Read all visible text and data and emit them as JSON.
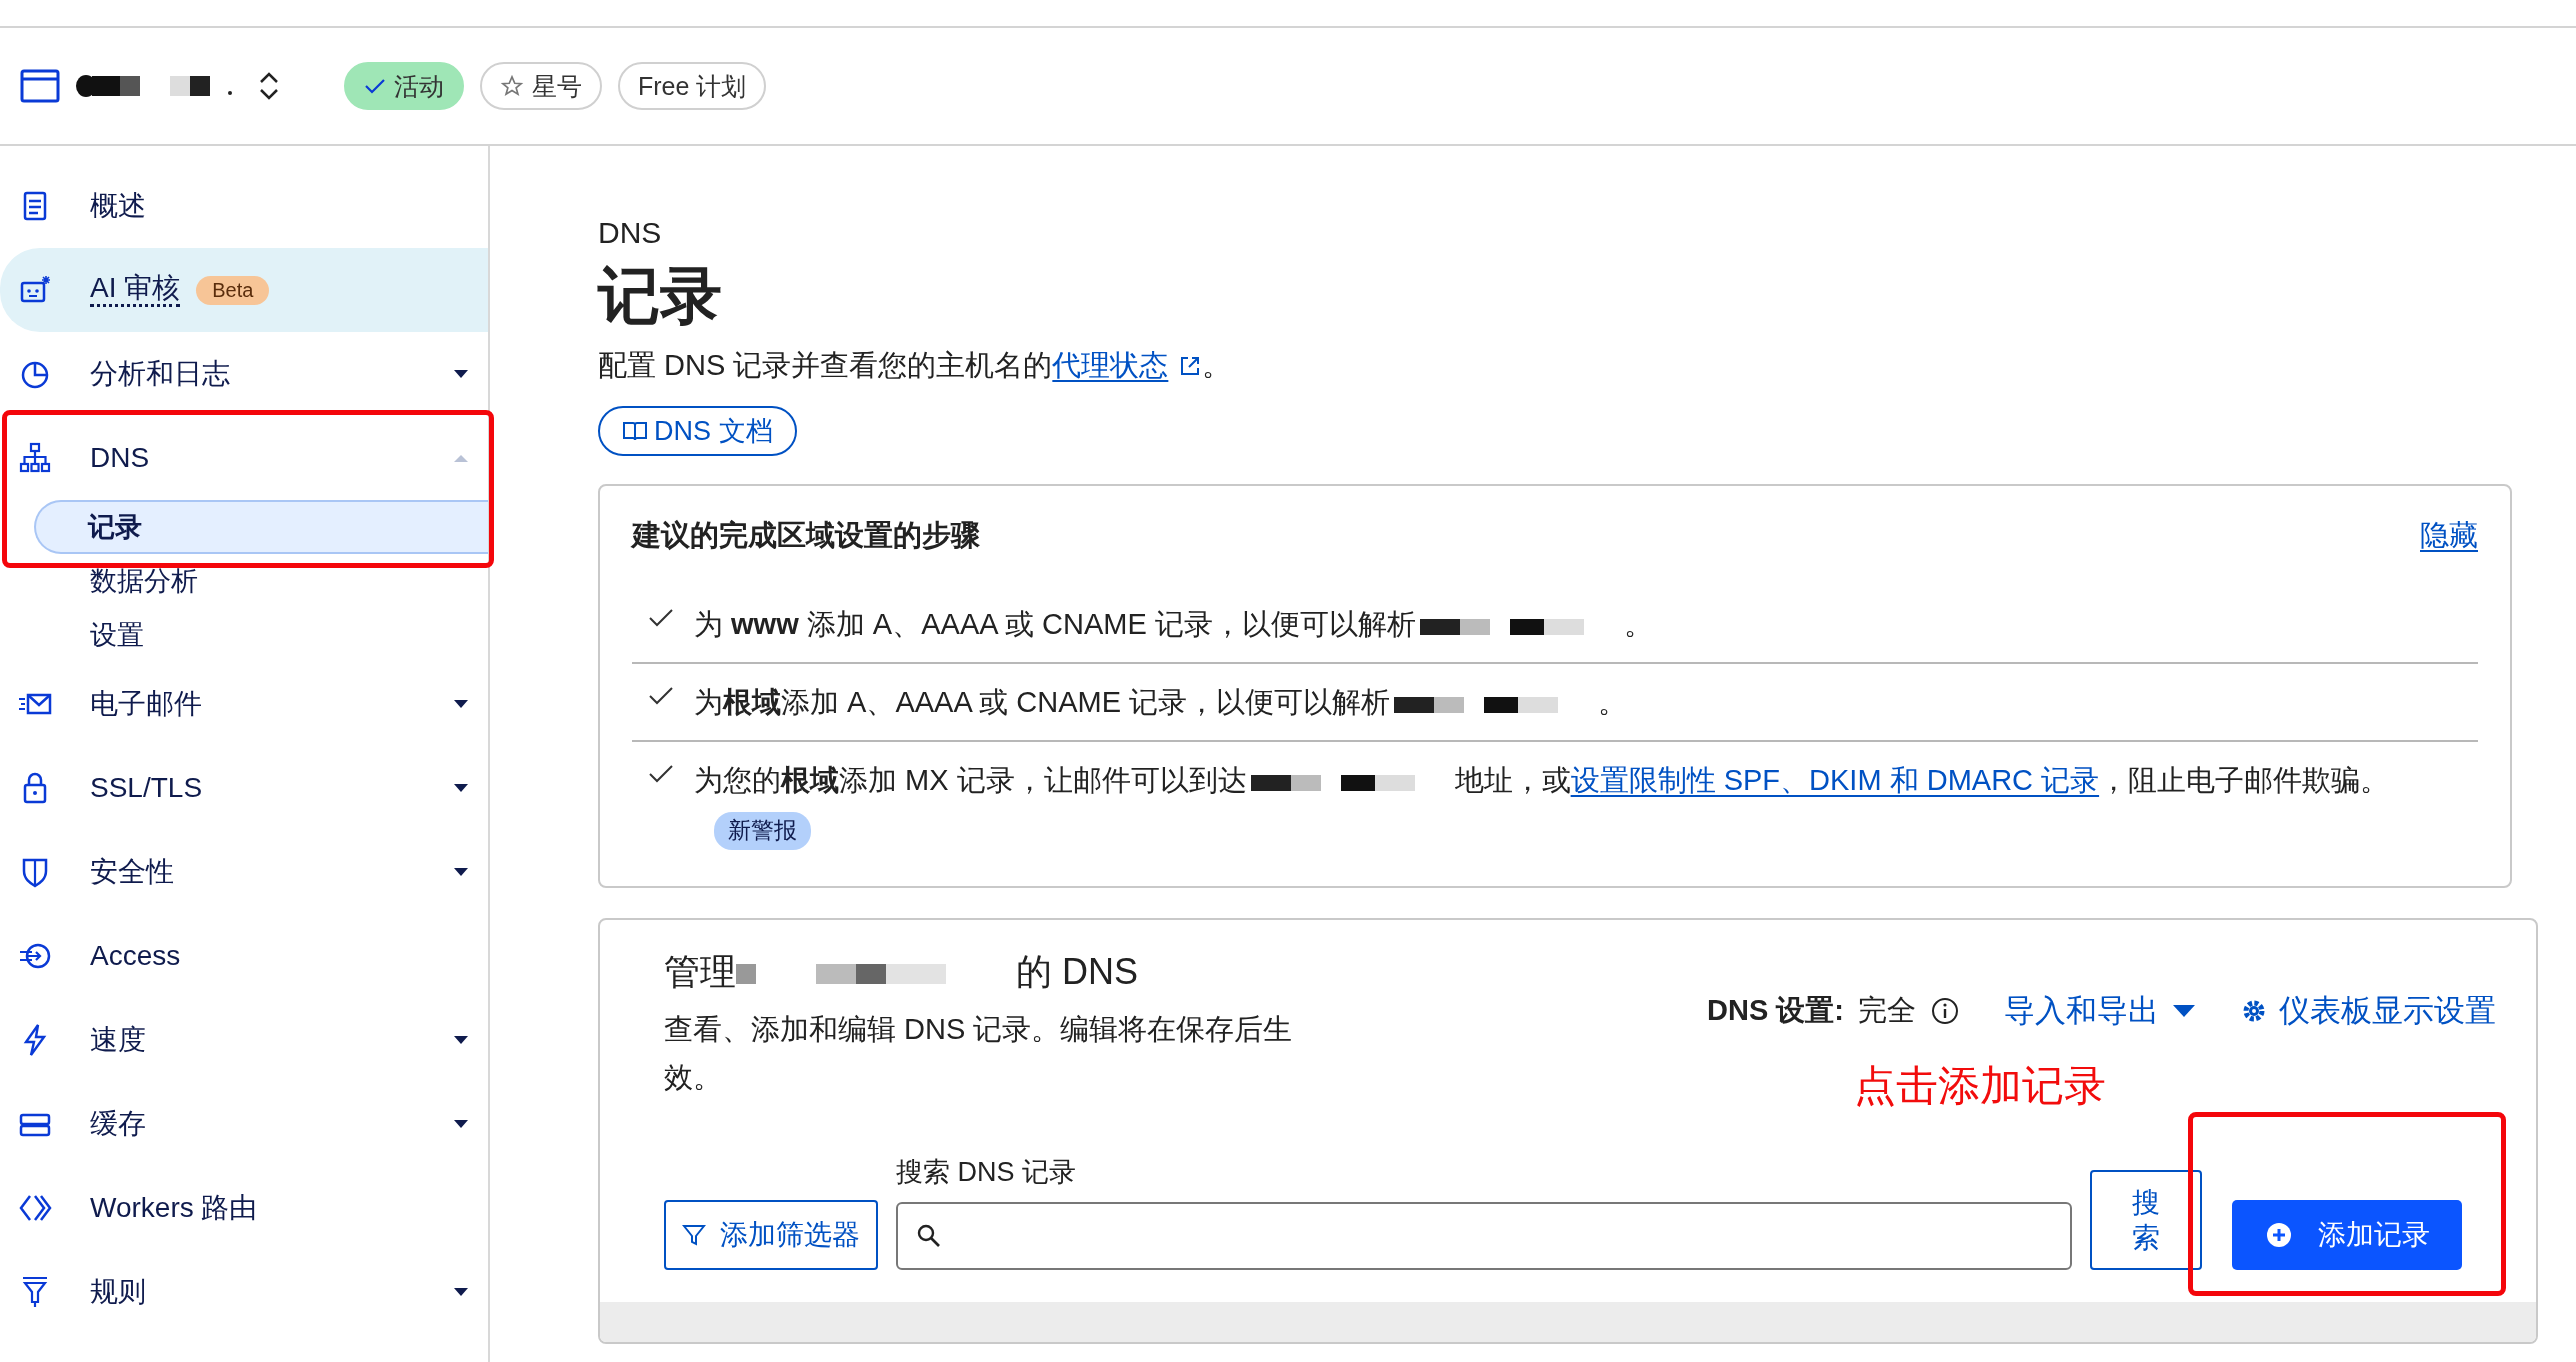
{
  "header": {
    "badges": [
      {
        "kind": "status",
        "label": "活动"
      },
      {
        "kind": "star",
        "label": "星号"
      },
      {
        "kind": "plan",
        "label": "Free 计划"
      }
    ]
  },
  "sidebar": {
    "items": [
      {
        "label": "概述",
        "highlighted": false
      },
      {
        "label": "AI 审核",
        "badge": "Beta",
        "highlighted": true
      },
      {
        "label": "分析和日志",
        "expanded": false,
        "highlighted": false
      },
      {
        "label": "DNS",
        "expanded": true,
        "highlighted": false,
        "children": [
          {
            "label": "记录",
            "selected": true
          },
          {
            "label": "数据分析",
            "selected": false
          },
          {
            "label": "设置",
            "selected": false
          }
        ]
      },
      {
        "label": "电子邮件",
        "expanded": false,
        "highlighted": false
      },
      {
        "label": "SSL/TLS",
        "expanded": false,
        "highlighted": false
      },
      {
        "label": "安全性",
        "expanded": false,
        "highlighted": false
      },
      {
        "label": "Access",
        "highlighted": false
      },
      {
        "label": "速度",
        "expanded": false,
        "highlighted": false
      },
      {
        "label": "缓存",
        "expanded": false,
        "highlighted": false
      },
      {
        "label": "Workers 路由",
        "highlighted": false
      },
      {
        "label": "规则",
        "expanded": false,
        "highlighted": false
      }
    ]
  },
  "page": {
    "section": "DNS",
    "title": "记录",
    "description": "配置 DNS 记录并查看您的主机名的",
    "description_link": "代理状态",
    "description_end": "。",
    "docs_button": "DNS 文档"
  },
  "setup_card": {
    "title": "建议的完成区域设置的步骤",
    "hide_link": "隐藏",
    "steps": [
      {
        "text": "为 **www** 添加 A、AAAA 或 CNAME 记录，以便可以解析",
        "after": "。"
      },
      {
        "text": "为**根域**添加 A、AAAA 或 CNAME 记录，以便可以解析",
        "after": "。"
      },
      {
        "text": "为您的**根域**添加 MX 记录，让邮件可以到达",
        "after": "地址，或",
        "link": "设置限制性 SPF、DKIM 和 DMARC 记录",
        "tail": "，阻止电子邮件欺骗。",
        "badge": "新警报"
      }
    ]
  },
  "manage_card": {
    "title_start": "管理",
    "title_end": "的 DNS",
    "description": "查看、添加和编辑 DNS 记录。编辑将在保存后生效。",
    "dns_setting_label": "DNS 设置:",
    "dns_setting_value": "完全",
    "import_export": "导入和导出",
    "dashboard_settings": "仪表板显示设置",
    "annotation": "点击添加记录",
    "filter_button": "添加筛选器",
    "search_label": "搜索 DNS 记录",
    "search_button": "搜索",
    "add_button": "添加记录"
  }
}
